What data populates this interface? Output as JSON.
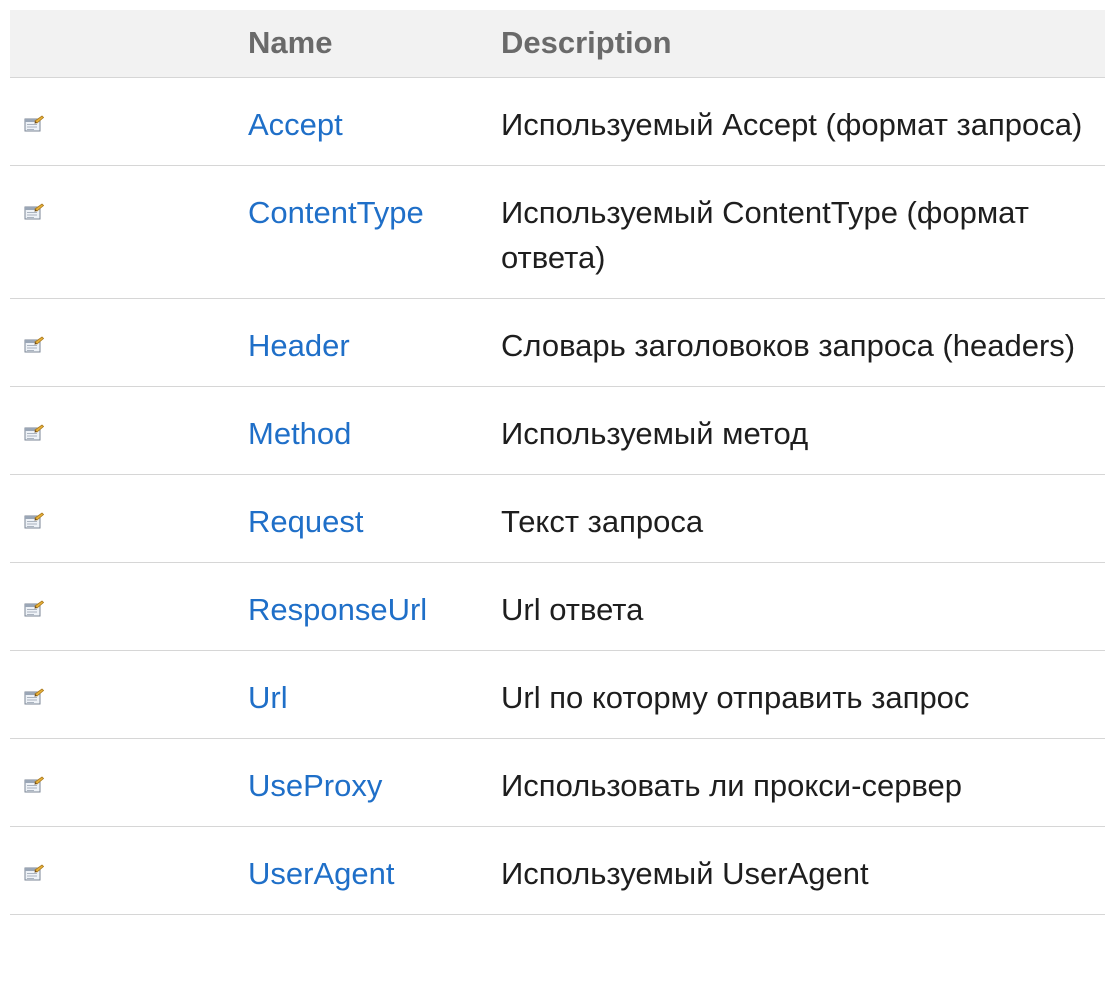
{
  "table": {
    "headers": {
      "icon": "",
      "name": "Name",
      "description": "Description"
    },
    "rows": [
      {
        "icon": "property-icon",
        "name": "Accept",
        "description": "Используемый Accept (формат запроса)"
      },
      {
        "icon": "property-icon",
        "name": "ContentType",
        "description": "Используемый ContentType (формат ответа)"
      },
      {
        "icon": "property-icon",
        "name": "Header",
        "description": "Словарь заголовоков запроса (headers)"
      },
      {
        "icon": "property-icon",
        "name": "Method",
        "description": "Используемый метод"
      },
      {
        "icon": "property-icon",
        "name": "Request",
        "description": "Текст запроса"
      },
      {
        "icon": "property-icon",
        "name": "ResponseUrl",
        "description": "Url ответа"
      },
      {
        "icon": "property-icon",
        "name": "Url",
        "description": "Url по которму отправить запрос"
      },
      {
        "icon": "property-icon",
        "name": "UseProxy",
        "description": "Использовать ли прокси-сервер"
      },
      {
        "icon": "property-icon",
        "name": "UserAgent",
        "description": "Используемый UserAgent"
      }
    ]
  },
  "colors": {
    "link": "#1f6fc8",
    "header_bg": "#f2f2f2",
    "header_text": "#6a6a6a",
    "divider": "#d6d6d6"
  }
}
